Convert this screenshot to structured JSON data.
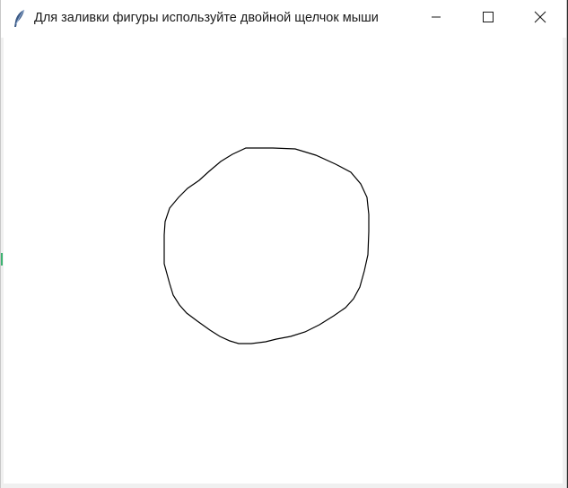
{
  "window": {
    "title": "Для заливки фигуры используйте двойной щелчок мыши",
    "app_icon": "feather-icon"
  },
  "caption_buttons": {
    "minimize": "minimize-icon",
    "maximize": "maximize-icon",
    "close": "close-icon"
  },
  "canvas": {
    "background": "#ffffff",
    "shape": {
      "kind": "freehand-closed-outline",
      "stroke": "#000000",
      "fill": "none"
    }
  }
}
